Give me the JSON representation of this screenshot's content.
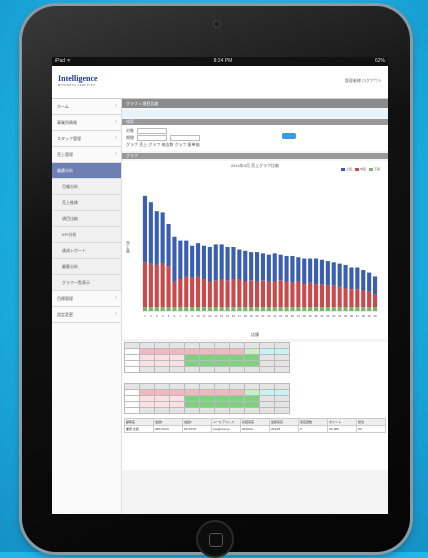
{
  "statusbar": {
    "left": "iPad ᯤ",
    "center": "8:24 PM",
    "right": "62%"
  },
  "header": {
    "logo": "Intelligence",
    "logo_sub": "BUSINESS SERVICES",
    "user": "管理者様 ログアウト"
  },
  "sidebar": {
    "items": [
      {
        "label": "ホーム",
        "active": false,
        "sub": false
      },
      {
        "label": "事業所情報",
        "active": false,
        "sub": false
      },
      {
        "label": "スタッフ管理",
        "active": false,
        "sub": false
      },
      {
        "label": "売上管理",
        "active": false,
        "sub": false
      },
      {
        "label": "業績分析",
        "active": true,
        "sub": false
      },
      {
        "label": "月報分析",
        "active": false,
        "sub": true
      },
      {
        "label": "売上推移",
        "active": false,
        "sub": true
      },
      {
        "label": "項目比較",
        "active": false,
        "sub": true
      },
      {
        "label": "KPI分析",
        "active": false,
        "sub": true
      },
      {
        "label": "達成レポート",
        "active": false,
        "sub": true
      },
      {
        "label": "顧客分析",
        "active": false,
        "sub": true
      },
      {
        "label": "グラフ一覧表示",
        "active": false,
        "sub": true
      },
      {
        "label": "目標管理",
        "active": false,
        "sub": false
      },
      {
        "label": "設定変更",
        "active": false,
        "sub": false
      }
    ]
  },
  "main": {
    "title": "グラフ > 項目比較",
    "tab": "検索",
    "section1": "検索",
    "form": {
      "row1_label": "対象",
      "row2_label": "期間",
      "row3_text": "グラフ 売上  グラフ 来店数  グラフ 客単価"
    },
    "section2": "グラフ"
  },
  "chart_data": {
    "type": "bar",
    "title": "2014年3月 売上グラフ比較",
    "xlabel": "店舗",
    "ylabel": "売上高",
    "legend": [
      "上段",
      "中段",
      "下段"
    ],
    "colors": [
      "#3b5fb0",
      "#c94a4a",
      "#7ab46b"
    ],
    "categories": [
      "1",
      "2",
      "3",
      "4",
      "5",
      "6",
      "7",
      "8",
      "9",
      "10",
      "11",
      "12",
      "13",
      "14",
      "15",
      "16",
      "17",
      "18",
      "19",
      "20",
      "21",
      "22",
      "23",
      "24",
      "25",
      "26",
      "27",
      "28",
      "29",
      "30",
      "31",
      "32",
      "33",
      "34",
      "35",
      "36",
      "37",
      "38",
      "39",
      "40"
    ],
    "series": [
      {
        "name": "下段",
        "values": [
          3,
          3,
          3,
          3,
          3,
          3,
          3,
          3,
          3,
          3,
          3,
          3,
          3,
          3,
          3,
          3,
          3,
          3,
          3,
          3,
          3,
          3,
          3,
          3,
          3,
          3,
          3,
          3,
          3,
          3,
          3,
          3,
          3,
          3,
          3,
          3,
          3,
          3,
          3,
          3
        ]
      },
      {
        "name": "中段",
        "values": [
          35,
          34,
          33,
          34,
          32,
          20,
          22,
          24,
          23,
          24,
          22,
          20,
          21,
          22,
          21,
          22,
          22,
          20,
          21,
          20,
          21,
          20,
          20,
          21,
          20,
          19,
          20,
          18,
          19,
          18,
          18,
          17,
          17,
          16,
          15,
          14,
          14,
          13,
          12,
          10
        ]
      },
      {
        "name": "上段",
        "values": [
          52,
          48,
          42,
          40,
          33,
          35,
          30,
          28,
          25,
          26,
          26,
          27,
          28,
          27,
          26,
          25,
          23,
          24,
          22,
          23,
          21,
          21,
          22,
          20,
          20,
          21,
          19,
          20,
          19,
          20,
          19,
          19,
          18,
          18,
          18,
          17,
          17,
          16,
          15,
          14
        ]
      }
    ],
    "ylim": [
      0,
      100
    ]
  },
  "table1": {
    "rows": [
      [
        "pink",
        "pink",
        "pink",
        "pink",
        "pink",
        "pink",
        "pink",
        "lgreen",
        "cyan",
        "cyan"
      ],
      [
        "lpink",
        "lpink",
        "lpink",
        "green",
        "green",
        "green",
        "green",
        "green",
        "gray",
        "gray"
      ],
      [
        "lpink",
        "lpink",
        "lpink",
        "green",
        "green",
        "green",
        "green",
        "green",
        "gray",
        "gray"
      ],
      [
        "gray",
        "gray",
        "gray",
        "gray",
        "gray",
        "gray",
        "gray",
        "gray",
        "gray",
        "gray"
      ]
    ]
  },
  "table2": {
    "rows": [
      [
        "pink",
        "pink",
        "pink",
        "pink",
        "pink",
        "pink",
        "pink",
        "lgreen",
        "cyan",
        "cyan"
      ],
      [
        "lpink",
        "lpink",
        "lpink",
        "green",
        "green",
        "green",
        "green",
        "green",
        "gray",
        "gray"
      ],
      [
        "lpink",
        "lpink",
        "lpink",
        "green",
        "green",
        "green",
        "green",
        "green",
        "gray",
        "gray"
      ],
      [
        "gray",
        "gray",
        "gray",
        "gray",
        "gray",
        "gray",
        "gray",
        "gray",
        "gray",
        "gray"
      ]
    ]
  },
  "bottom_table": {
    "headers": [
      "顧客名",
      "電話1",
      "電話2",
      "メールアドレス",
      "初回来店",
      "最終来店",
      "来店回数",
      "ポイント",
      "担当"
    ],
    "row": [
      "業者 太郎",
      "090-XXXX",
      "03-XXXX",
      "xxx@xxxx.jp",
      "2013/12",
      "2014/3",
      "5",
      "XX,000",
      "XX"
    ]
  }
}
